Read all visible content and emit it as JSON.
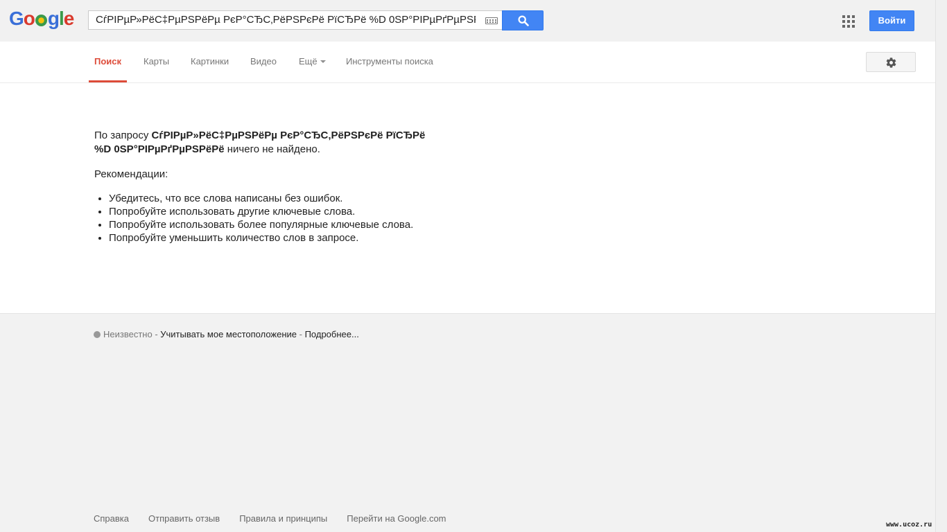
{
  "header": {
    "logo_text": "Google",
    "search_query": "СѓРІРµР»РёС‡РµРЅРёРµ РєР°СЂС‚РёРЅРєРё РїСЂРё %D 0SР°РІРµРґРµРЅРёРё",
    "search_button_icon": "search-icon",
    "keyboard_icon": "keyboard-icon",
    "apps_icon": "apps-grid-icon",
    "signin_label": "Войти",
    "accent_color": "#4285f4"
  },
  "nav": {
    "tabs": [
      {
        "label": "Поиск",
        "active": true
      },
      {
        "label": "Карты"
      },
      {
        "label": "Картинки"
      },
      {
        "label": "Видео"
      },
      {
        "label": "Ещё"
      },
      {
        "label": "Инструменты поиска"
      }
    ],
    "settings_icon": "gear-icon",
    "active_color": "#dd4b39"
  },
  "results": {
    "prefix": "По запросу ",
    "query_line1": "СѓРІРµР»РёС‡РµРЅРёРµ РєР°СЂС‚РёРЅРєРё РїСЂРё",
    "query_line2": "%D 0SР°РІРµРґРµРЅРёРё",
    "suffix": " ничего не найдено.",
    "recommendations_title": "Рекомендации:",
    "tips": [
      "Убедитесь, что все слова написаны без ошибок.",
      "Попробуйте использовать другие ключевые слова.",
      "Попробуйте использовать более популярные ключевые слова.",
      "Попробуйте уменьшить количество слов в запросе."
    ]
  },
  "footer": {
    "location_status": "Неизвестно",
    "separator": " - ",
    "use_location": "Учитывать мое местоположение",
    "more": "Подробнее...",
    "links": [
      "Справка",
      "Отправить отзыв",
      "Правила и принципы",
      "Перейти на Google.com"
    ]
  },
  "watermark": "www.ucoz.ru"
}
